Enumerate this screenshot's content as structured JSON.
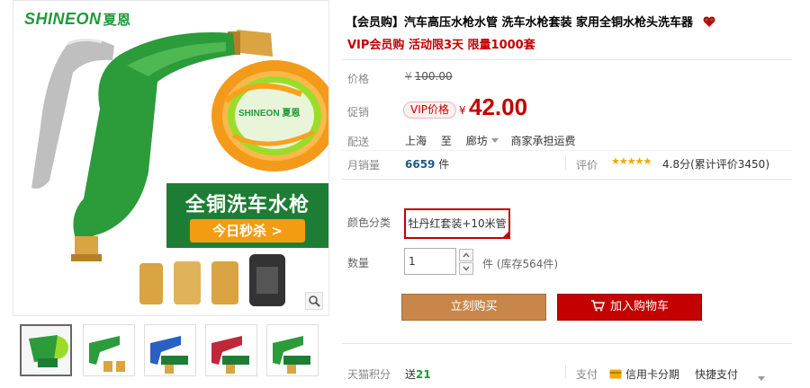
{
  "gallery": {
    "brand": {
      "latin": "SHINEON",
      "cn": "夏恩"
    },
    "promo_title": "全铜洗车水枪",
    "promo_sub": "今日秒杀 >",
    "hose_brand": "SHINEON 夏恩",
    "thumbnails": [
      {
        "name": "thumb-1",
        "active": true
      },
      {
        "name": "thumb-2",
        "active": false
      },
      {
        "name": "thumb-3",
        "active": false
      },
      {
        "name": "thumb-4",
        "active": false
      },
      {
        "name": "thumb-5",
        "active": false
      }
    ]
  },
  "product": {
    "title": "【会员购】汽车高压水枪水管 洗车水枪套装 家用全铜水枪头洗车器",
    "subtitle": "VIP会员购 活动限3天 限量1000套",
    "price_label": "价格",
    "currency_symbol": "¥",
    "original_price": "100.00",
    "promo_label": "促销",
    "vip_tag": "VIP价格",
    "promo_price": "42.00",
    "shipping_label": "配送",
    "ship_from": "上海",
    "ship_to_word": "至",
    "ship_to": "廊坊",
    "shipping_fee": "商家承担运费",
    "monthly_sales_label": "月销量",
    "monthly_sales_value": "6659",
    "monthly_sales_unit": "件",
    "rating_label": "评价",
    "rating_stars": 5,
    "rating_score": "4.8分",
    "rating_count_text": "(累计评价3450)",
    "color_label": "颜色分类",
    "color_option": "牡丹红套装+10米管",
    "quantity_label": "数量",
    "quantity_value": "1",
    "stock_text": "件 (库存564件)",
    "buy_now": "立刻购买",
    "add_to_cart": "加入购物车",
    "tmall_points_label": "天猫积分",
    "tmall_points_prefix": "送",
    "tmall_points_value": "21",
    "payment_label": "支付",
    "credit_installment": "信用卡分期",
    "quick_pay": "快捷支付"
  },
  "colors": {
    "accent_red": "#c40000",
    "buy_now_bg": "#c7874a",
    "brand_green": "#1f9a3a"
  }
}
